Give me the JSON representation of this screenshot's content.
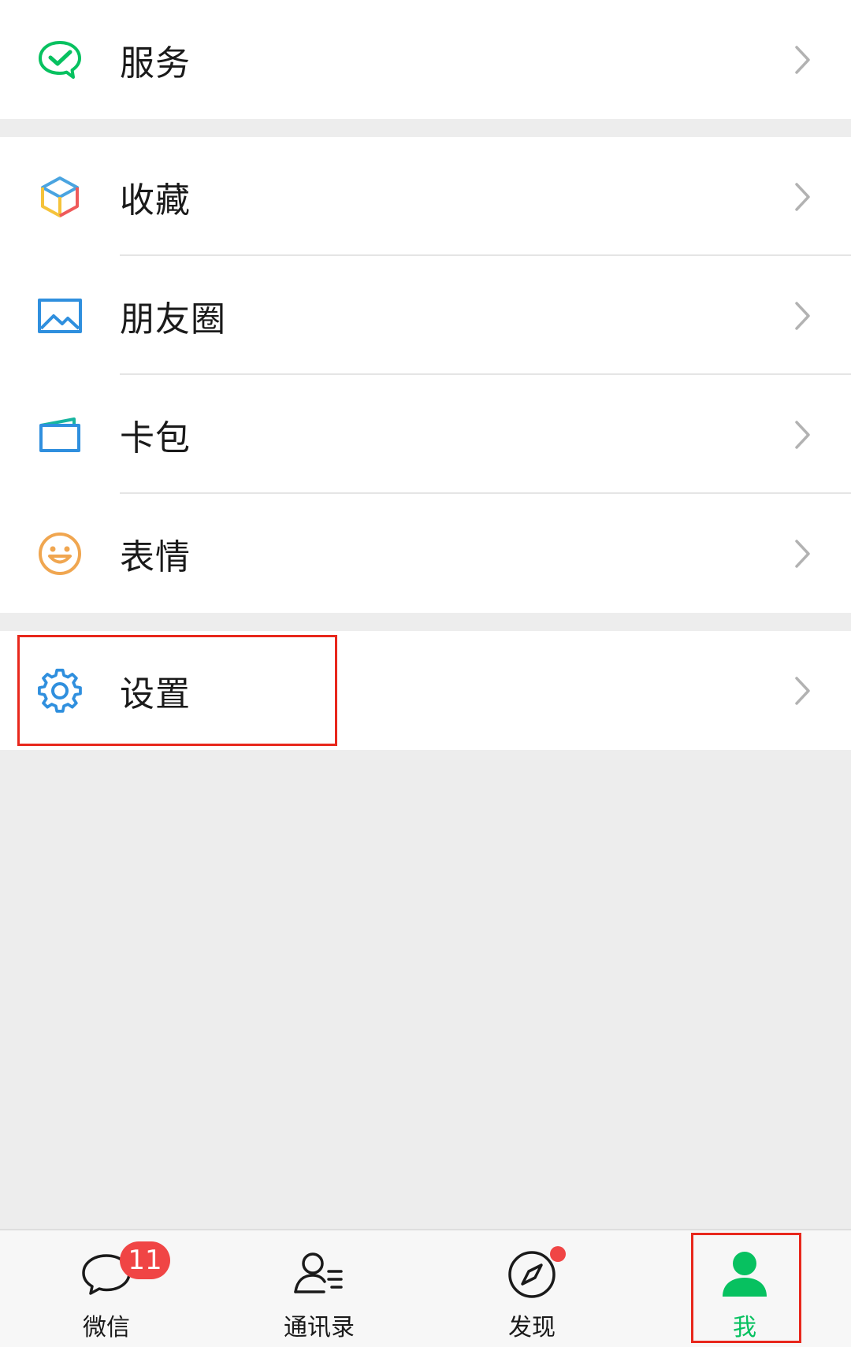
{
  "menu": {
    "service": {
      "label": "服务",
      "icon": "wechat-pay-icon"
    },
    "favorites": {
      "label": "收藏",
      "icon": "cube-icon"
    },
    "moments": {
      "label": "朋友圈",
      "icon": "image-icon"
    },
    "cards": {
      "label": "卡包",
      "icon": "wallet-icon"
    },
    "stickers": {
      "label": "表情",
      "icon": "smiley-icon"
    },
    "settings": {
      "label": "设置",
      "icon": "gear-icon"
    }
  },
  "tabbar": {
    "chats": {
      "label": "微信",
      "badge": "11",
      "icon": "chat-bubble-icon"
    },
    "contacts": {
      "label": "通讯录",
      "icon": "contacts-icon"
    },
    "discover": {
      "label": "发现",
      "icon": "compass-icon",
      "has_dot": true
    },
    "me": {
      "label": "我",
      "icon": "person-icon",
      "active": true
    }
  },
  "colors": {
    "accent_green": "#07c160",
    "badge_red": "#f04545",
    "highlight_red": "#e8271c"
  }
}
